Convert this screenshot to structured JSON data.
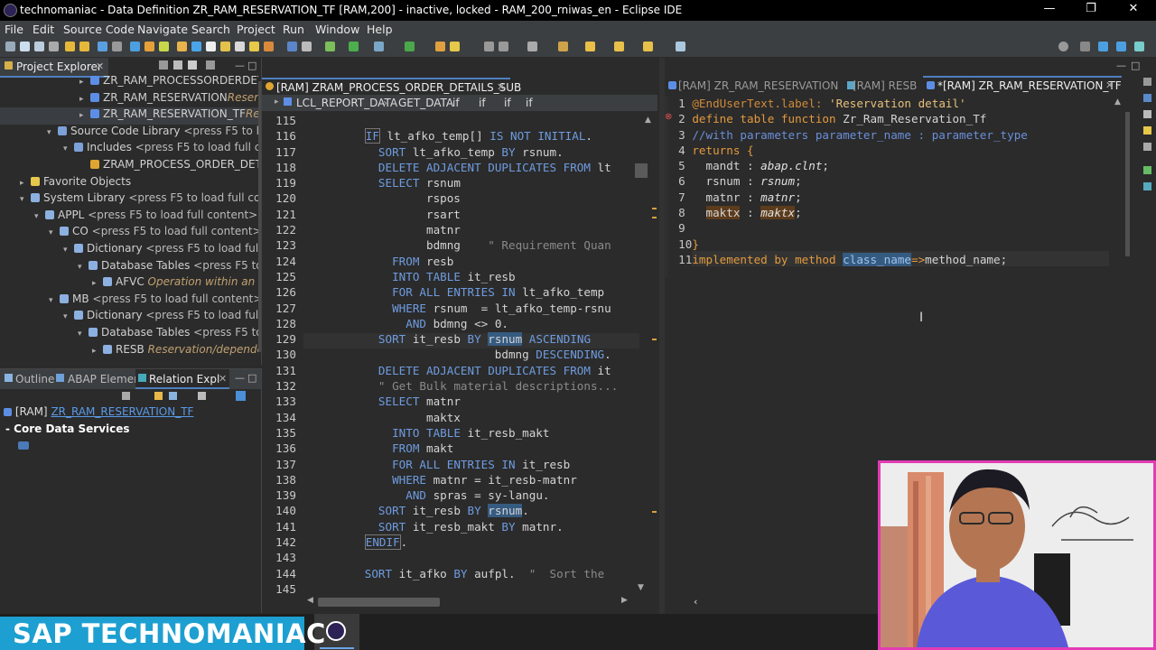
{
  "window": {
    "title": "technomaniac - Data Definition ZR_RAM_RESERVATION_TF [RAM,200] - inactive, locked - RAM_200_rniwas_en - Eclipse IDE",
    "min_glyph": "—",
    "max_glyph": "❐",
    "close_glyph": "✕"
  },
  "menu": [
    "File",
    "Edit",
    "Source Code",
    "Navigate",
    "Search",
    "Project",
    "Run",
    "Window",
    "Help"
  ],
  "project_explorer": {
    "tab_label": "Project Explorer",
    "rows": [
      {
        "indent": 88,
        "arrow": "▸",
        "icon": "#5d8ee6",
        "label": "ZR_RAM_PROCESSORDERDETAI",
        "hint": "",
        "italic": ""
      },
      {
        "indent": 88,
        "arrow": "▸",
        "icon": "#5d8ee6",
        "label": "ZR_RAM_RESERVATION",
        "hint": "",
        "italic": "Reserve"
      },
      {
        "indent": 88,
        "arrow": "▸",
        "icon": "#5d8ee6",
        "label": "ZR_RAM_RESERVATION_TF",
        "hint": "",
        "italic": "Rese"
      },
      {
        "indent": 52,
        "arrow": "▾",
        "icon": "#7ca0d8",
        "label": "Source Code Library",
        "hint": " <press F5 to load",
        "italic": ""
      },
      {
        "indent": 70,
        "arrow": "▾",
        "icon": "#7ca0d8",
        "label": "Includes",
        "hint": " <press F5 to load full cont",
        "italic": ""
      },
      {
        "indent": 88,
        "arrow": "",
        "icon": "#e0a530",
        "label": "ZRAM_PROCESS_ORDER_DETAIL",
        "hint": "",
        "italic": ""
      },
      {
        "indent": 22,
        "arrow": "▸",
        "icon": "#e6c84a",
        "label": "Favorite Objects",
        "hint": "",
        "italic": ""
      },
      {
        "indent": 22,
        "arrow": "▾",
        "icon": "#8cb0e0",
        "label": "System Library",
        "hint": " <press F5 to load full content",
        "italic": ""
      },
      {
        "indent": 38,
        "arrow": "▾",
        "icon": "#8cb0e0",
        "label": "APPL",
        "hint": " <press F5 to load full content>",
        "italic": " Str"
      },
      {
        "indent": 54,
        "arrow": "▾",
        "icon": "#8cb0e0",
        "label": "CO",
        "hint": " <press F5 to load full content>",
        "italic": " Ap"
      },
      {
        "indent": 70,
        "arrow": "▾",
        "icon": "#8cb0e0",
        "label": "Dictionary",
        "hint": " <press F5 to load full co",
        "italic": ""
      },
      {
        "indent": 86,
        "arrow": "▾",
        "icon": "#8cb0e0",
        "label": "Database Tables",
        "hint": " <press F5 to lo",
        "italic": ""
      },
      {
        "indent": 102,
        "arrow": "▸",
        "icon": "#8cb0e0",
        "label": "AFVC",
        "hint": "",
        "italic": " Operation within an o"
      },
      {
        "indent": 54,
        "arrow": "▾",
        "icon": "#8cb0e0",
        "label": "MB",
        "hint": " <press F5 to load full content>",
        "italic": " A"
      },
      {
        "indent": 70,
        "arrow": "▾",
        "icon": "#8cb0e0",
        "label": "Dictionary",
        "hint": " <press F5 to load full co",
        "italic": ""
      },
      {
        "indent": 86,
        "arrow": "▾",
        "icon": "#8cb0e0",
        "label": "Database Tables",
        "hint": " <press F5 to lo",
        "italic": ""
      },
      {
        "indent": 102,
        "arrow": "▸",
        "icon": "#8cb0e0",
        "label": "RESB",
        "hint": "",
        "italic": " Reservation/dependen"
      }
    ]
  },
  "bottom_views": {
    "tabs": [
      "Outline",
      "ABAP Elemen",
      "Relation Expl"
    ],
    "root_prefix": "[RAM]",
    "root_link": "ZR_RAM_RESERVATION_TF",
    "section": "- Core Data Services"
  },
  "editor1": {
    "tab_label": "[RAM] ZRAM_PROCESS_ORDER_DETAILS_SUB",
    "breadcrumb": [
      "LCL_REPORT_DATA",
      "GET_DATA",
      "if",
      "if",
      "if",
      "if"
    ]
  },
  "editor2": {
    "tabs": [
      "[RAM] ZR_RAM_RESERVATION",
      "[RAM] RESB",
      "*[RAM] ZR_RAM_RESERVATION_TF"
    ]
  },
  "brand": {
    "text": "SAP TECHNOMANIAC"
  }
}
